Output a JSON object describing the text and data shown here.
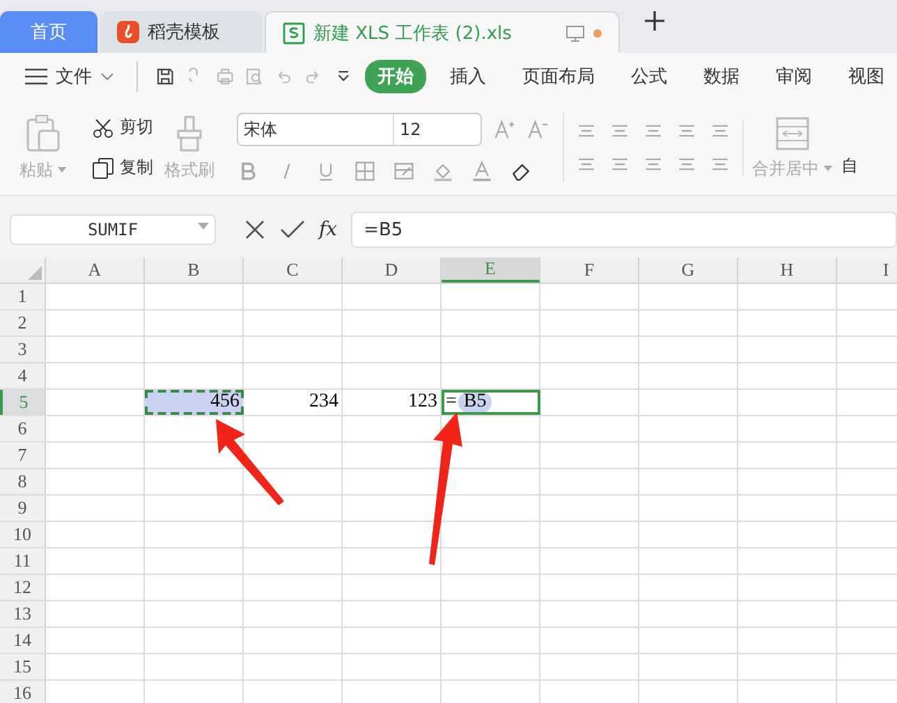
{
  "tabs": [
    {
      "label": "首页",
      "kind": "home",
      "selected": false
    },
    {
      "label": "稻壳模板",
      "kind": "template",
      "selected": false
    },
    {
      "label": "新建 XLS 工作表 (2).xls",
      "kind": "document",
      "selected": true,
      "unsaved": true
    }
  ],
  "menu": {
    "file": "文件",
    "ribbon_tabs": [
      {
        "label": "开始",
        "selected": true
      },
      {
        "label": "插入",
        "selected": false
      },
      {
        "label": "页面布局",
        "selected": false
      },
      {
        "label": "公式",
        "selected": false
      },
      {
        "label": "数据",
        "selected": false
      },
      {
        "label": "审阅",
        "selected": false
      },
      {
        "label": "视图",
        "selected": false
      }
    ]
  },
  "toolbar": {
    "paste": "粘贴",
    "cut": "剪切",
    "copy": "复制",
    "format_painter": "格式刷",
    "font": "宋体",
    "font_size": "12",
    "merge": "合并居中",
    "cut_off": "自"
  },
  "formula_bar": {
    "name_box": "SUMIF",
    "fx": "fx",
    "formula": "=B5"
  },
  "columns": [
    {
      "label": "A",
      "selected": false
    },
    {
      "label": "B",
      "selected": false
    },
    {
      "label": "C",
      "selected": false
    },
    {
      "label": "D",
      "selected": false
    },
    {
      "label": "E",
      "selected": true
    },
    {
      "label": "F",
      "selected": false
    },
    {
      "label": "G",
      "selected": false
    },
    {
      "label": "H",
      "selected": false
    },
    {
      "label": "I",
      "selected": false
    }
  ],
  "rows": [
    {
      "label": "1",
      "selected": false
    },
    {
      "label": "2",
      "selected": false
    },
    {
      "label": "3",
      "selected": false
    },
    {
      "label": "4",
      "selected": false
    },
    {
      "label": "5",
      "selected": true,
      "cells": [
        {
          "kind": "empty"
        },
        {
          "kind": "copied",
          "value": "456"
        },
        {
          "kind": "number",
          "value": "234"
        },
        {
          "kind": "number",
          "value": "123"
        },
        {
          "kind": "editing",
          "value": "=",
          "reference": "B5"
        }
      ]
    },
    {
      "label": "6",
      "selected": false
    },
    {
      "label": "7",
      "selected": false
    },
    {
      "label": "8",
      "selected": false
    },
    {
      "label": "9",
      "selected": false
    },
    {
      "label": "10",
      "selected": false
    },
    {
      "label": "11",
      "selected": false
    },
    {
      "label": "12",
      "selected": false
    },
    {
      "label": "13",
      "selected": false
    },
    {
      "label": "14",
      "selected": false
    },
    {
      "label": "15",
      "selected": false
    },
    {
      "label": "16",
      "selected": false
    }
  ],
  "annotations": [
    {
      "kind": "arrow"
    },
    {
      "kind": "arrow"
    }
  ]
}
